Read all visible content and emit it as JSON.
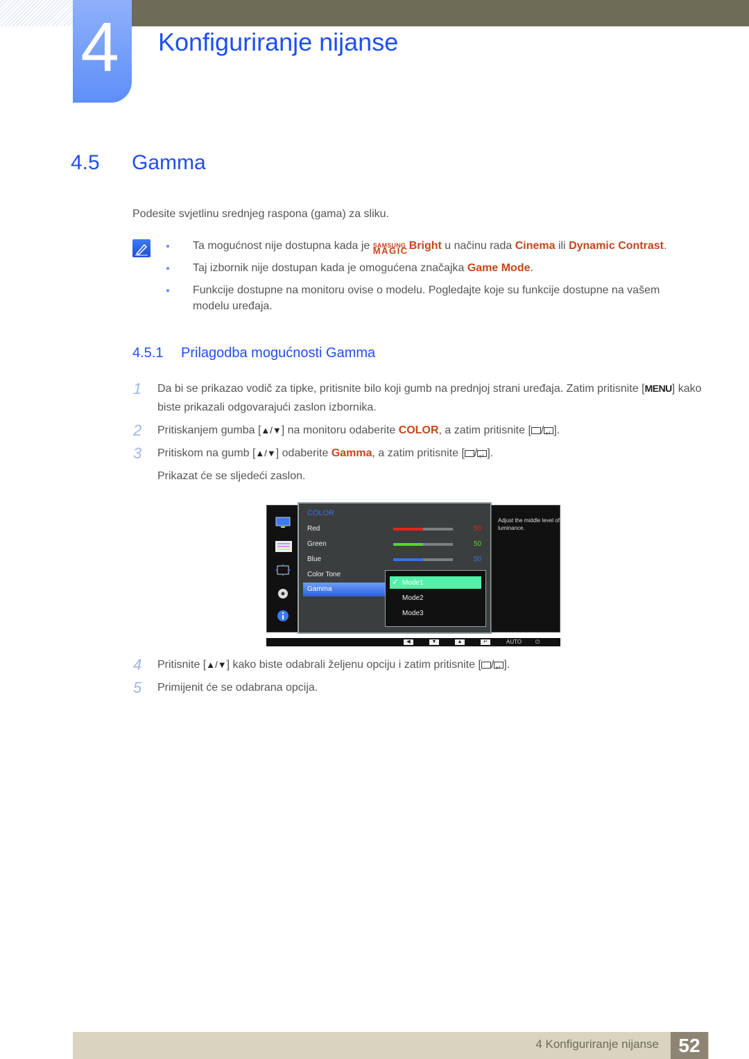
{
  "chapter": {
    "number": "4",
    "title": "Konfiguriranje nijanse"
  },
  "section": {
    "number": "4.5",
    "title": "Gamma",
    "intro": "Podesite svjetlinu srednjeg raspona (gama) za sliku."
  },
  "notes": {
    "icon": "note-pencil-icon",
    "items": [
      {
        "t1": "Ta mogućnost nije dostupna kada je ",
        "magic_top": "SAMSUNG",
        "magic_bottom": "MAGIC",
        "h1": "Bright",
        "t2": " u načinu rada ",
        "h2": "Cinema",
        "t3": " ili ",
        "h3": "Dynamic Contrast",
        "t4": "."
      },
      {
        "t1": "Taj izbornik nije dostupan kada je omogućena značajka ",
        "h1": "Game Mode",
        "t2": "."
      },
      {
        "t1": "Funkcije dostupne na monitoru ovise o modelu. Pogledajte koje su funkcije dostupne na vašem modelu uređaja."
      }
    ]
  },
  "subsection": {
    "number": "4.5.1",
    "title": "Prilagodba mogućnosti Gamma"
  },
  "steps": [
    {
      "n": "1",
      "t1": "Da bi se prikazao vodič za tipke, pritisnite bilo koji gumb na prednjoj strani uređaja. Zatim pritisnite [",
      "key": "MENU",
      "t2": "] kako biste prikazali odgovarajući zaslon izbornika."
    },
    {
      "n": "2",
      "t1": "Pritiskanjem gumba [",
      "arrows": "▲/▼",
      "t2": "] na monitoru odaberite ",
      "h1": "COLOR",
      "t3": ", a zatim pritisnite [",
      "t4": "]."
    },
    {
      "n": "3",
      "t1": "Pritiskom na gumb [",
      "arrows": "▲/▼",
      "t2": "] odaberite ",
      "h1": "Gamma",
      "t3": ", a zatim pritisnite [",
      "t4": "].",
      "after": "Prikazat će se sljedeći zaslon."
    },
    {
      "n": "4",
      "t1": "Pritisnite [",
      "arrows": "▲/▼",
      "t2": "] kako biste odabrali željenu opciju i zatim pritisnite [",
      "t3": "]."
    },
    {
      "n": "5",
      "t1": "Primijenit će se odabrana opcija."
    }
  ],
  "osd": {
    "menu_title": "COLOR",
    "sidebar_icons": [
      "picture-icon",
      "onscreen-display-icon",
      "position-icon",
      "setup-gear-icon",
      "information-icon"
    ],
    "rows": [
      {
        "label": "Red",
        "value": "50",
        "level": 0.5,
        "color": "#e8221c"
      },
      {
        "label": "Green",
        "value": "50",
        "level": 0.5,
        "color": "#57d81b"
      },
      {
        "label": "Blue",
        "value": "50",
        "level": 0.5,
        "color": "#3673e8"
      },
      {
        "label": "Color Tone"
      },
      {
        "label": "Gamma",
        "selected": true
      }
    ],
    "options": [
      {
        "label": "Mode1",
        "active": true
      },
      {
        "label": "Mode2"
      },
      {
        "label": "Mode3"
      }
    ],
    "help_text": "Adjust the middle level of luminance.",
    "footer": {
      "buttons": [
        "◀",
        "▼",
        "▲",
        "↵"
      ],
      "auto": "AUTO",
      "power": "⏻"
    }
  },
  "footer": {
    "text": "4 Konfiguriranje nijanse",
    "page": "52"
  }
}
